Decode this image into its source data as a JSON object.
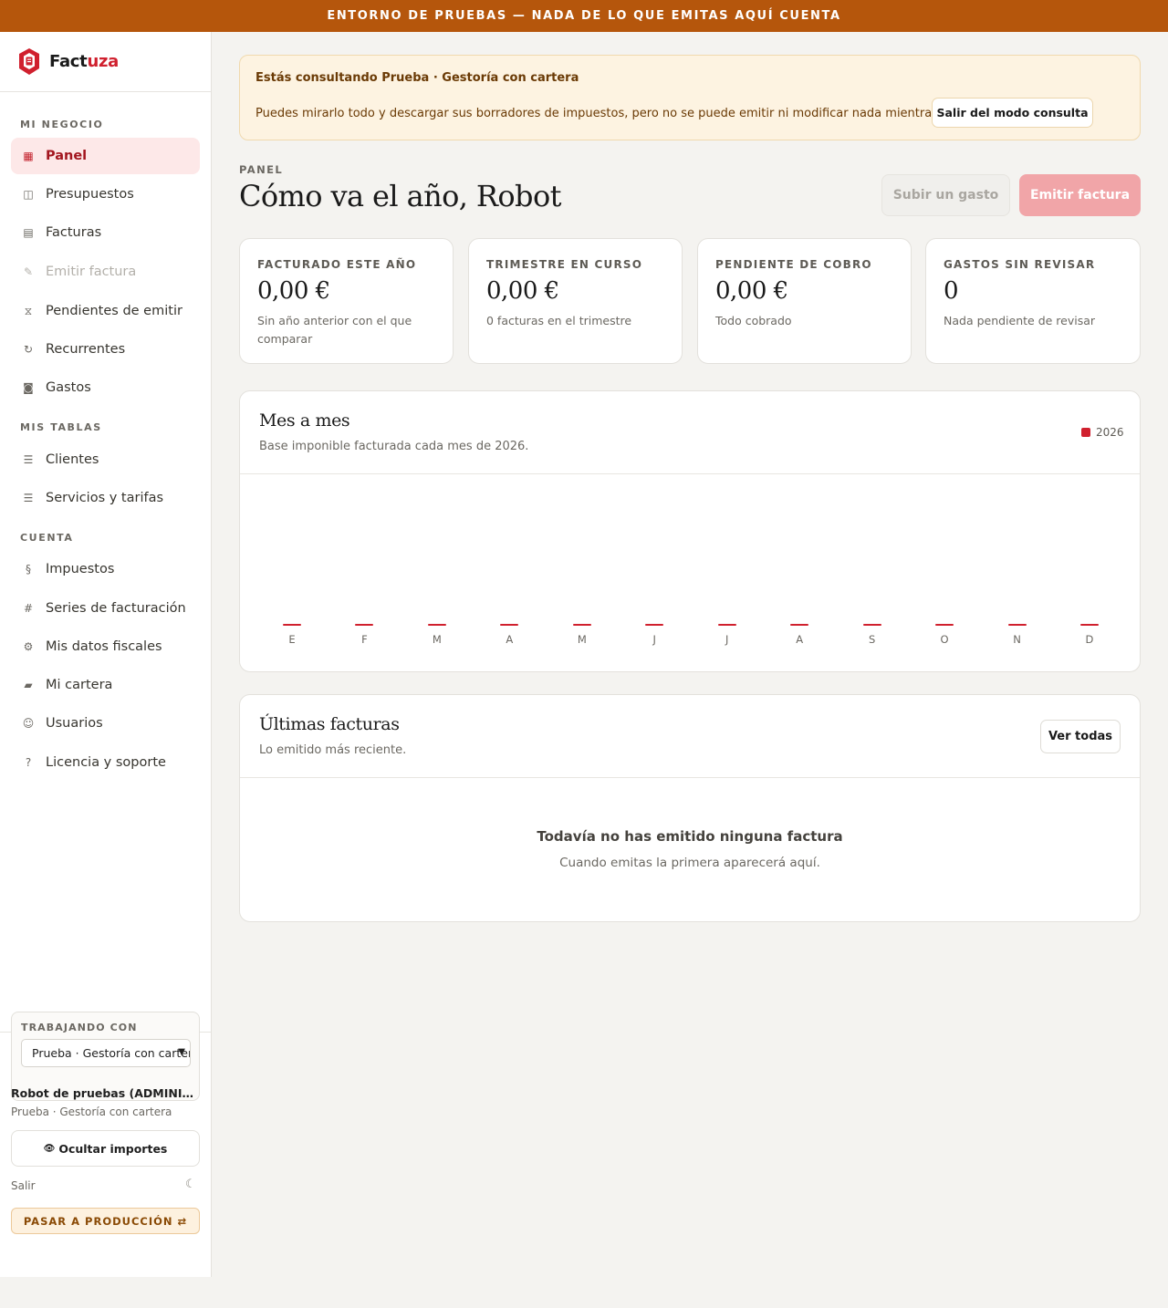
{
  "banner": "ENTORNO DE PRUEBAS — NADA DE LO QUE EMITAS AQUÍ CUENTA",
  "brand": {
    "name_part1": "Fact",
    "name_part2": "uza",
    "accent_color": "#d0202e"
  },
  "sidebar": {
    "sections": [
      {
        "label": "MI NEGOCIO"
      },
      {
        "label": "MIS TABLAS"
      },
      {
        "label": "CUENTA"
      }
    ],
    "items": [
      {
        "label": "Panel",
        "icon": "grid-icon",
        "active": true
      },
      {
        "label": "Presupuestos",
        "icon": "book-icon"
      },
      {
        "label": "Facturas",
        "icon": "list-icon"
      },
      {
        "label": "Emitir factura",
        "icon": "pen-icon",
        "disabled": true
      },
      {
        "label": "Pendientes de emitir",
        "icon": "hourglass-icon"
      },
      {
        "label": "Recurrentes",
        "icon": "refresh-icon"
      },
      {
        "label": "Gastos",
        "icon": "camera-icon"
      },
      {
        "label": "Clientes",
        "icon": "menu-icon"
      },
      {
        "label": "Servicios y tarifas",
        "icon": "menu-icon"
      },
      {
        "label": "Impuestos",
        "icon": "section-icon"
      },
      {
        "label": "Series de facturación",
        "icon": "hash-icon"
      },
      {
        "label": "Mis datos fiscales",
        "icon": "gear-icon"
      },
      {
        "label": "Mi cartera",
        "icon": "briefcase-icon"
      },
      {
        "label": "Usuarios",
        "icon": "user-icon"
      },
      {
        "label": "Licencia y soporte",
        "icon": "help-icon"
      }
    ],
    "working_with": {
      "label": "TRABAJANDO CON",
      "selected": "Prueba · Gestoría con cartera"
    },
    "user": {
      "name": "Robot de pruebas (ADMINISTRADOR)",
      "org": "Prueba · Gestoría con cartera"
    },
    "hide_amounts": "Ocultar importes",
    "logout": "Salir",
    "to_production": "PASAR A PRODUCCIÓN ⇄"
  },
  "alert": {
    "title": "Estás consultando Prueba · Gestoría con cartera",
    "text": "Puedes mirarlo todo y descargar sus borradores de impuestos, pero no se puede emitir ni modificar nada mientras estés así.",
    "button": "Salir del modo consulta"
  },
  "header": {
    "eyebrow": "PANEL",
    "title": "Cómo va el año, Robot",
    "upload_button": "Subir un gasto",
    "issue_button": "Emitir factura"
  },
  "kpis": [
    {
      "label": "FACTURADO ESTE AÑO",
      "value": "0,00 €",
      "note": "Sin año anterior con el que comparar"
    },
    {
      "label": "TRIMESTRE EN CURSO",
      "value": "0,00 €",
      "note": "0 facturas en el trimestre"
    },
    {
      "label": "PENDIENTE DE COBRO",
      "value": "0,00 €",
      "note": "Todo cobrado"
    },
    {
      "label": "GASTOS SIN REVISAR",
      "value": "0",
      "note": "Nada pendiente de revisar"
    }
  ],
  "monthly": {
    "title": "Mes a mes",
    "subtitle": "Base imponible facturada cada mes de 2026.",
    "legend": "2026"
  },
  "chart_data": {
    "type": "bar",
    "categories": [
      "E",
      "F",
      "M",
      "A",
      "M",
      "J",
      "J",
      "A",
      "S",
      "O",
      "N",
      "D"
    ],
    "series": [
      {
        "name": "2026",
        "values": [
          0,
          0,
          0,
          0,
          0,
          0,
          0,
          0,
          0,
          0,
          0,
          0
        ],
        "color": "#d0202e"
      }
    ],
    "title": "Mes a mes",
    "grid": false,
    "legend_position": "top-right"
  },
  "latest": {
    "title": "Últimas facturas",
    "subtitle": "Lo emitido más reciente.",
    "view_all": "Ver todas",
    "empty_title": "Todavía no has emitido ninguna factura",
    "empty_sub": "Cuando emitas la primera aparecerá aquí."
  }
}
